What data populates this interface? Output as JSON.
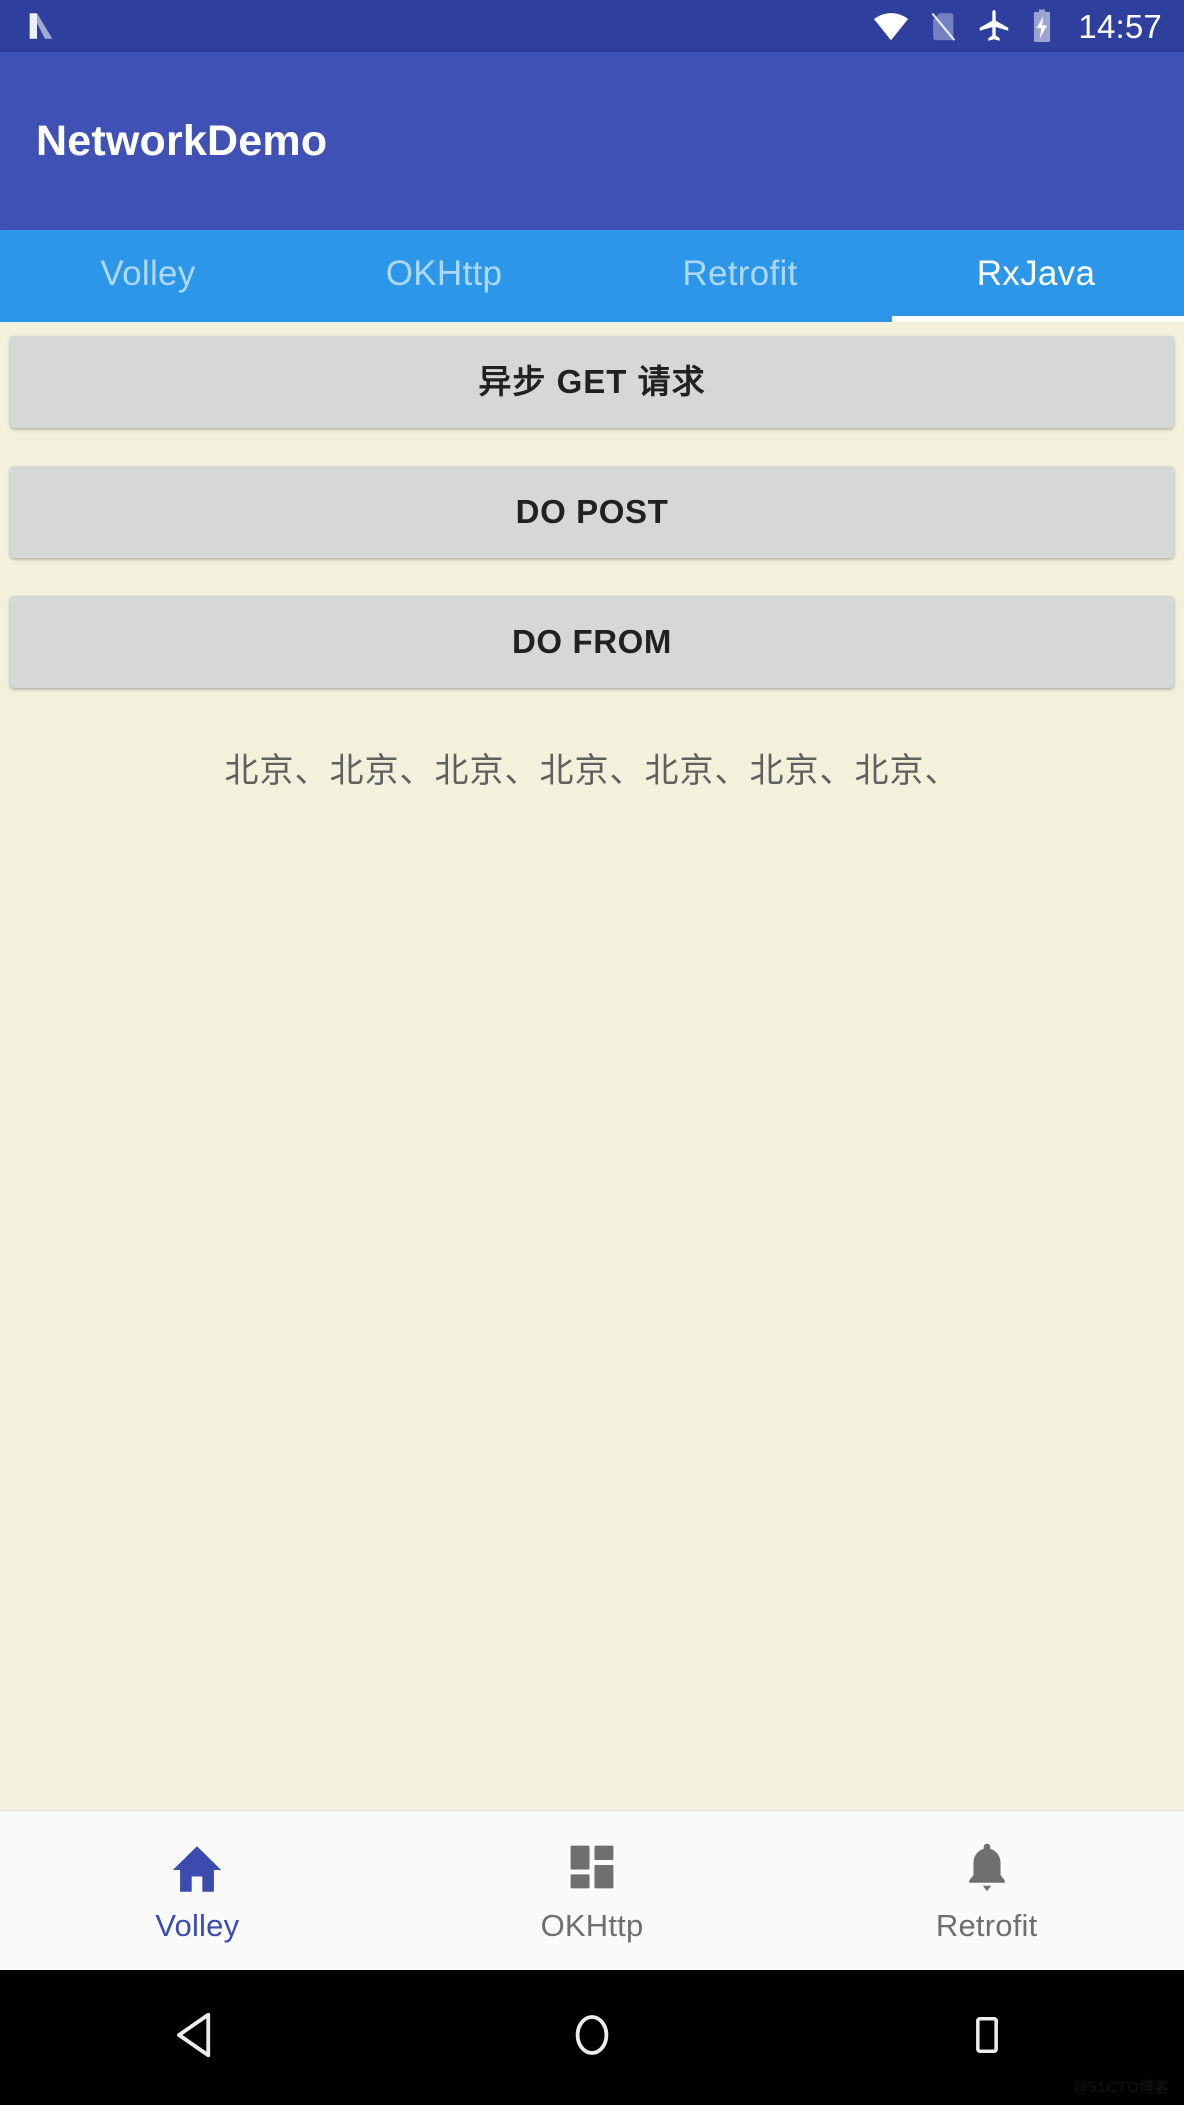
{
  "status_bar": {
    "carrier_icon": "android-n-logo",
    "icons": [
      "wifi-icon",
      "no-sim-icon",
      "airplane-mode-icon",
      "battery-charging-icon"
    ],
    "time": "14:57",
    "background_color": "#2E3F9E"
  },
  "app_bar": {
    "title": "NetworkDemo",
    "background_color": "#3F51B5",
    "text_color": "#FFFFFF"
  },
  "tab_bar": {
    "background_color": "#2C97E8",
    "indicator_color": "#FFFFFF",
    "selected_index": 3,
    "tabs": [
      {
        "label": "Volley"
      },
      {
        "label": "OKHttp"
      },
      {
        "label": "Retrofit"
      },
      {
        "label": "RxJava"
      }
    ]
  },
  "content": {
    "background_color": "#F2F2DC",
    "buttons": [
      {
        "label": "异步 GET 请求",
        "name": "async-get-request-button"
      },
      {
        "label": "DO POST",
        "name": "do-post-button"
      },
      {
        "label": "DO FROM",
        "name": "do-from-button"
      }
    ],
    "result_text": "北京、北京、北京、北京、北京、北京、北京、"
  },
  "bottom_nav": {
    "background_color": "#FAFAFA",
    "selected_color": "#3B4CAE",
    "unselected_color": "#6F6F6F",
    "selected_index": 0,
    "items": [
      {
        "label": "Volley",
        "icon": "home-icon"
      },
      {
        "label": "OKHttp",
        "icon": "dashboard-icon"
      },
      {
        "label": "Retrofit",
        "icon": "notifications-bell-icon"
      }
    ]
  },
  "system_nav": {
    "background_color": "#000000",
    "buttons": [
      {
        "name": "back-button",
        "icon": "back-triangle-icon"
      },
      {
        "name": "home-button",
        "icon": "home-circle-icon"
      },
      {
        "name": "recents-button",
        "icon": "recents-square-icon"
      }
    ]
  },
  "watermark": "@51CTO博客"
}
